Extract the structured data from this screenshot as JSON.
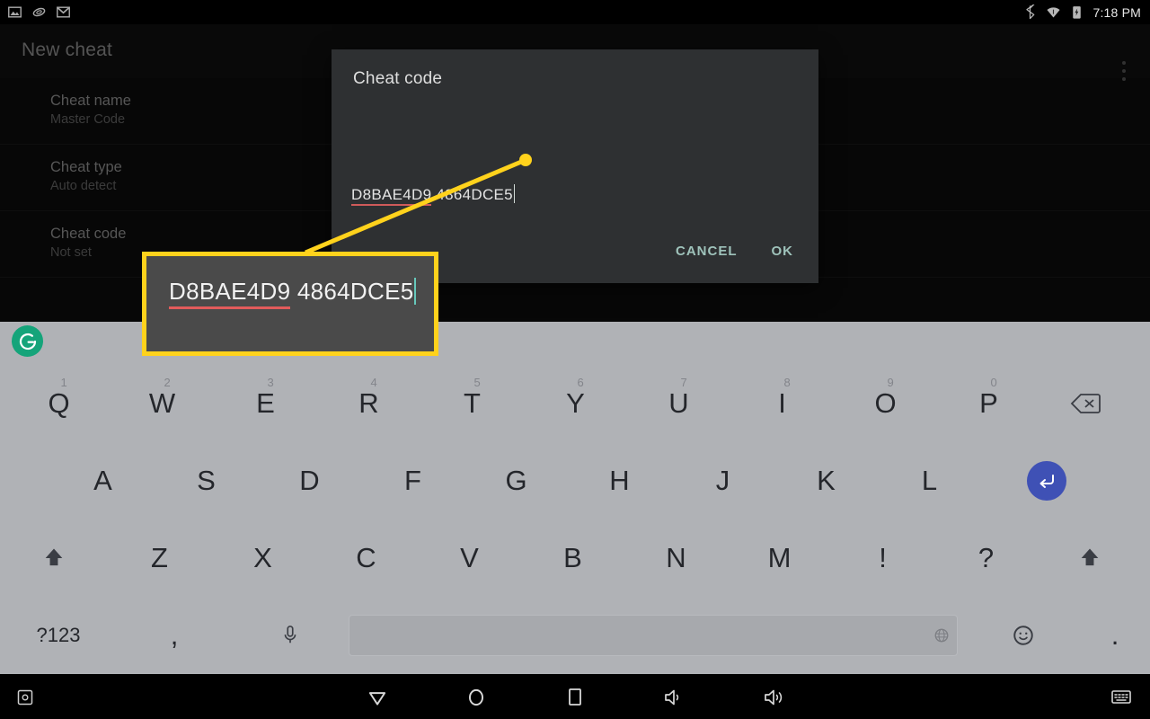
{
  "status_bar": {
    "left_icons": [
      "photo-icon",
      "clip-icon",
      "gmail-icon"
    ],
    "right_icons": [
      "bluetooth-icon",
      "wifi-icon",
      "battery-charging-icon"
    ],
    "time": "7:18 PM"
  },
  "app": {
    "title": "New cheat",
    "overflow_label": "More options",
    "preferences": [
      {
        "title": "Cheat name",
        "subtitle": "Master Code"
      },
      {
        "title": "Cheat type",
        "subtitle": "Auto detect"
      },
      {
        "title": "Cheat code",
        "subtitle": "Not set"
      }
    ]
  },
  "dialog": {
    "title": "Cheat code",
    "input_value_misspelled": "D8BAE4D9",
    "input_value_rest": " 4864DCE5",
    "input_full_value": "D8BAE4D9 4864DCE5",
    "cancel_label": "CANCEL",
    "ok_label": "OK",
    "accent_color": "#9fc3bb",
    "underline_color": "#4e6d66",
    "spellcheck_color": "#cf5a5a"
  },
  "annotation": {
    "highlight_color": "#ffd21c",
    "magnified_misspelled": "D8BAE4D9",
    "magnified_rest": " 4864DCE5",
    "caret_color": "#67c8bb"
  },
  "keyboard": {
    "assistant_icon": "grammarly-icon",
    "row1": [
      {
        "label": "Q",
        "hint": "1"
      },
      {
        "label": "W",
        "hint": "2"
      },
      {
        "label": "E",
        "hint": "3"
      },
      {
        "label": "R",
        "hint": "4"
      },
      {
        "label": "T",
        "hint": "5"
      },
      {
        "label": "Y",
        "hint": "6"
      },
      {
        "label": "U",
        "hint": "7"
      },
      {
        "label": "I",
        "hint": "8"
      },
      {
        "label": "O",
        "hint": "9"
      },
      {
        "label": "P",
        "hint": "0"
      }
    ],
    "row2": [
      "A",
      "S",
      "D",
      "F",
      "G",
      "H",
      "J",
      "K",
      "L"
    ],
    "row3": [
      "Z",
      "X",
      "C",
      "V",
      "B",
      "N",
      "M",
      "!",
      "?"
    ],
    "backspace_label": "backspace-key",
    "enter_label": "enter-key",
    "shift_left_label": "shift-key",
    "shift_right_label": "shift-key",
    "symbols_label": "?123",
    "comma_label": ",",
    "mic_label": "microphone-key",
    "space_label": "space-key",
    "emoji_label": "emoji-key",
    "period_label": ".",
    "globe_label": "language-switch-icon"
  },
  "nav_bar": {
    "screenshot_label": "screenshot-button",
    "back_label": "back-button",
    "home_label": "home-button",
    "recents_label": "recents-button",
    "volume_down_label": "volume-down-button",
    "volume_up_label": "volume-up-button",
    "keyboard_label": "hide-keyboard-button"
  }
}
